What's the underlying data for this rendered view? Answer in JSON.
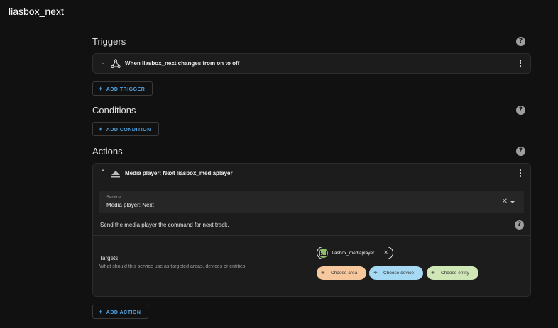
{
  "app": {
    "title": "liasbox_next"
  },
  "triggers": {
    "heading": "Triggers",
    "items": [
      {
        "title": "When liasbox_next changes from on to off"
      }
    ],
    "add_label": "ADD TRIGGER"
  },
  "conditions": {
    "heading": "Conditions",
    "add_label": "ADD CONDITION"
  },
  "actions": {
    "heading": "Actions",
    "items": [
      {
        "title": "Media player: Next liasbox_mediaplayer",
        "service_label": "Service",
        "service_value": "Media player: Next",
        "description": "Send the media player the command for next track.",
        "targets_title": "Targets",
        "targets_subtitle": "What should this service use as targeted areas, devices or entities.",
        "selected_entity": "liasbox_mediaplayer",
        "choose_area": "Choose area",
        "choose_device": "Choose device",
        "choose_entity": "Choose entity"
      }
    ],
    "add_label": "ADD ACTION"
  },
  "icons": {
    "help": "help-circle-icon",
    "trigger": "state-trigger-icon",
    "action": "media-eject-icon",
    "entity": "cast-icon",
    "menu": "more-vertical-icon",
    "clear": "close-icon",
    "dropdown": "caret-down-icon",
    "add": "plus-icon"
  },
  "colors": {
    "background": "#111111",
    "card": "#1c1c1c",
    "accent": "#4fa3e3",
    "chip_area": "#f7c89d",
    "chip_device": "#a6d9f4",
    "chip_entity": "#cfe6b6"
  }
}
